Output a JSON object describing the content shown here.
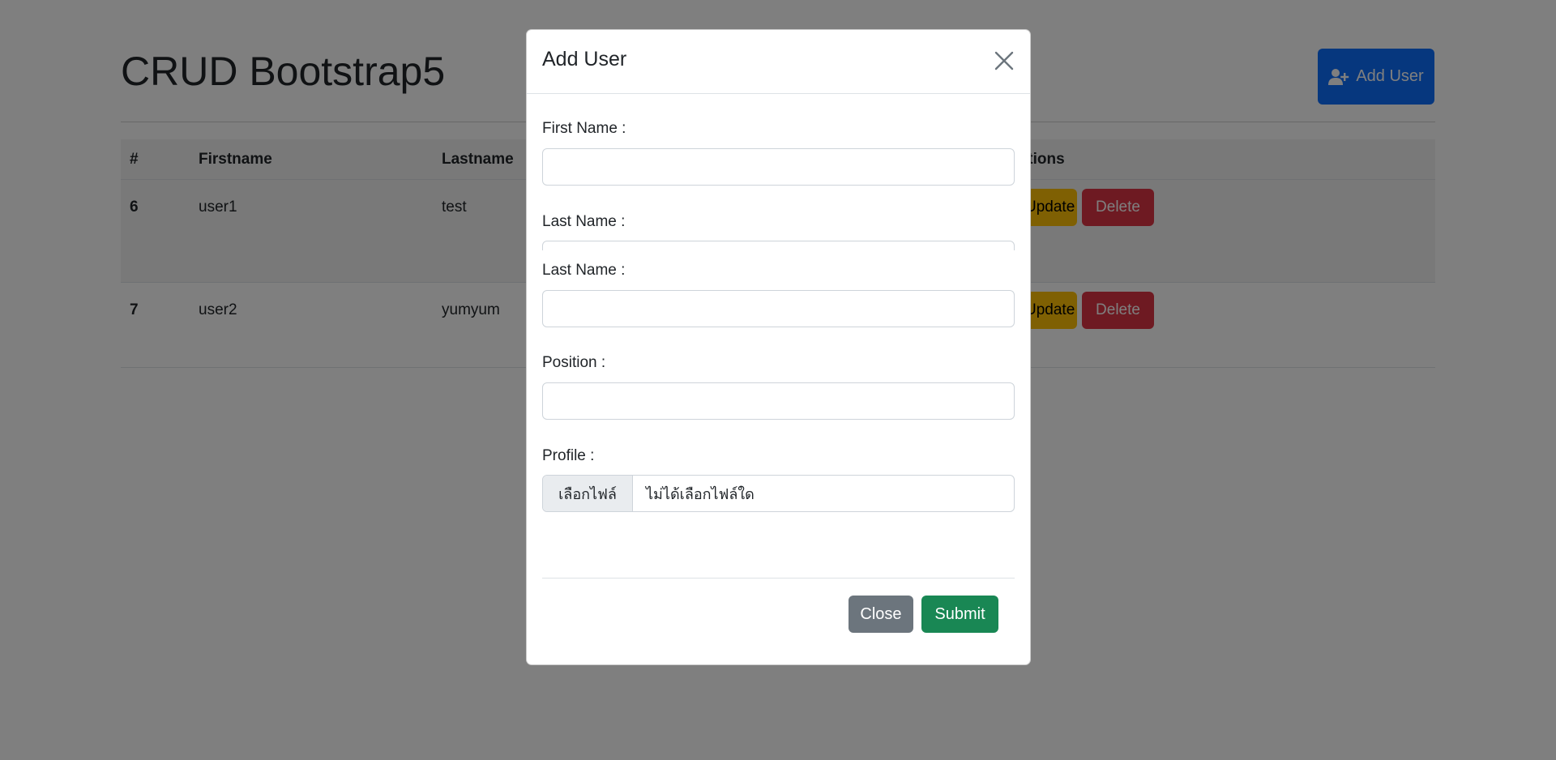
{
  "page": {
    "title": "CRUD Bootstrap5",
    "add_button_label": "Add User",
    "table": {
      "headers": [
        "#",
        "Firstname",
        "Lastname",
        "Actions"
      ],
      "rows": [
        {
          "id": "6",
          "firstname": "user1",
          "lastname": "test",
          "update_label": "Update",
          "delete_label": "Delete"
        },
        {
          "id": "7",
          "firstname": "user2",
          "lastname": "yumyum",
          "update_label": "Update",
          "delete_label": "Delete"
        }
      ]
    }
  },
  "modal": {
    "title": "Add User",
    "fields": {
      "first_name_label": "First Name :",
      "last_name_label_clipped": "Last Name :",
      "last_name_label": "Last Name :",
      "position_label": "Position :",
      "profile_label": "Profile :"
    },
    "file": {
      "button_label": "เลือกไฟล์",
      "status_text": "ไม่ได้เลือกไฟล์ใด"
    },
    "close_label": "Close",
    "submit_label": "Submit"
  },
  "colors": {
    "primary": "#0d6efd",
    "warning": "#ffc107",
    "danger": "#dc3545",
    "secondary": "#6c757d",
    "success": "#198754"
  }
}
